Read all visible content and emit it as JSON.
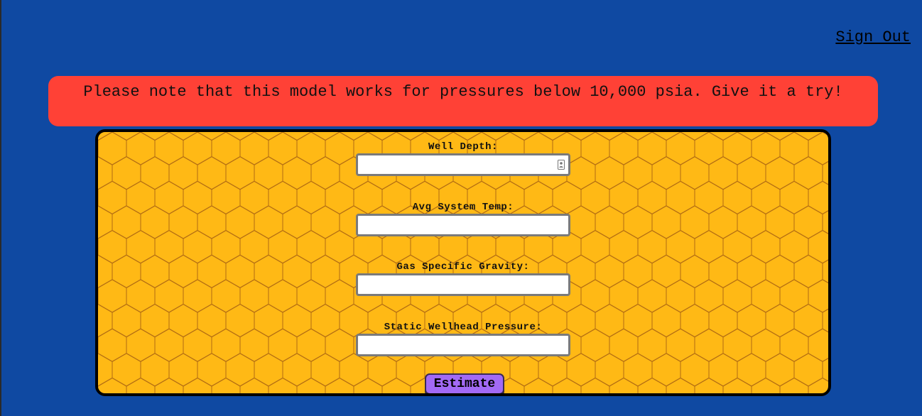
{
  "header": {
    "sign_out_label": "Sign Out"
  },
  "notice": {
    "text": "Please note that this model works for pressures below 10,000 psia. Give it a try!"
  },
  "form": {
    "fields": [
      {
        "label": "Well Depth:",
        "value": "",
        "placeholder": ""
      },
      {
        "label": "Avg System Temp:",
        "value": "",
        "placeholder": ""
      },
      {
        "label": "Gas Specific Gravity:",
        "value": "",
        "placeholder": ""
      },
      {
        "label": "Static Wellhead Pressure:",
        "value": "",
        "placeholder": ""
      }
    ],
    "submit_label": "Estimate"
  },
  "colors": {
    "background": "#0f49a2",
    "notice": "#ff4136",
    "panel": "#ffb915",
    "hex_lines": "#b06a12",
    "button": "#a26af5"
  },
  "icons": {
    "autofill": "contact-card-icon"
  }
}
